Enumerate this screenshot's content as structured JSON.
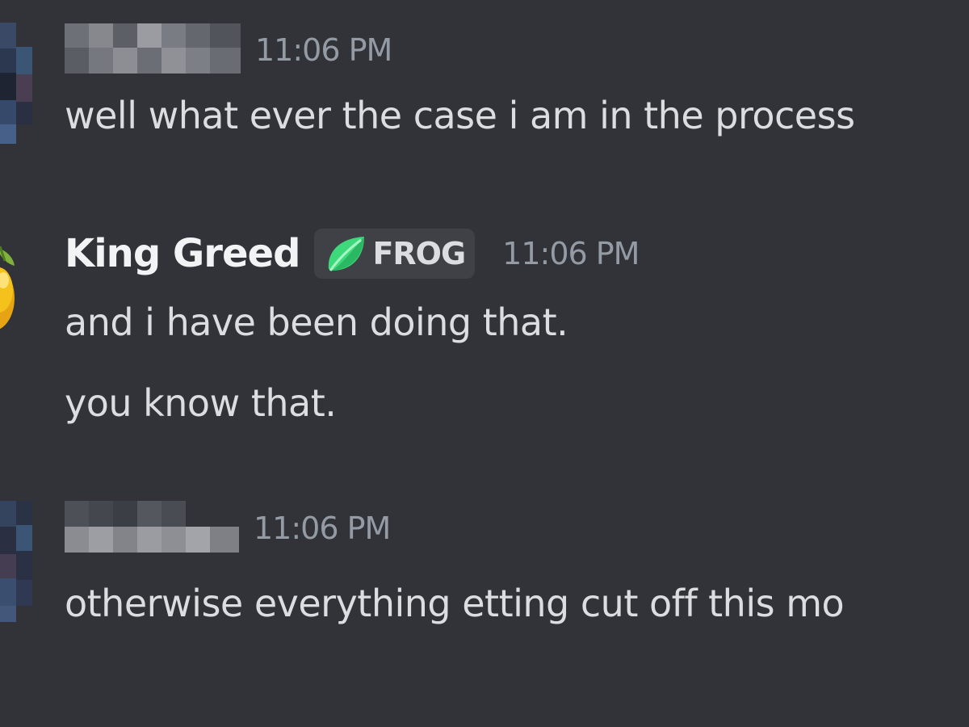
{
  "messages": [
    {
      "author_hidden": true,
      "timestamp": "11:06 PM",
      "lines": [
        "well what ever the case i am in the process"
      ]
    },
    {
      "author": "King Greed",
      "author_hidden": false,
      "badge": {
        "icon": "leaf-icon",
        "label": "FROG",
        "icon_color": "#3dd97a"
      },
      "timestamp": "11:06 PM",
      "lines": [
        "and i have been doing that.",
        "you know that."
      ]
    },
    {
      "author_hidden": true,
      "timestamp": "11:06 PM",
      "lines": [
        "otherwise everything etting cut off this mo"
      ]
    }
  ],
  "colors": {
    "background": "#313338",
    "text": "#dbdee1",
    "username": "#f2f3f5",
    "timestamp": "#949ba4",
    "badge_bg": "#3f4147"
  }
}
